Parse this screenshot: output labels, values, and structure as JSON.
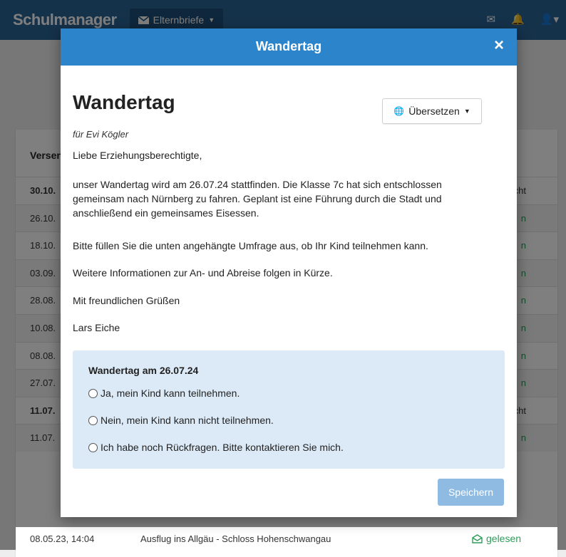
{
  "app": {
    "brand": "Schulmanager",
    "nav_dropdown": "Elternbriefe",
    "nav_icons": [
      "mail-icon",
      "bell-icon",
      "user-icon"
    ]
  },
  "list": {
    "header": "Versendet",
    "rows": [
      {
        "date": "30.10.",
        "status": "cht",
        "bold": true
      },
      {
        "date": "26.10.",
        "status": "n",
        "bold": false
      },
      {
        "date": "18.10.",
        "status": "n",
        "bold": false
      },
      {
        "date": "03.09.",
        "status": "n",
        "bold": false
      },
      {
        "date": "28.08.",
        "status": "n",
        "bold": false
      },
      {
        "date": "10.08.",
        "status": "n",
        "bold": false
      },
      {
        "date": "08.08.",
        "status": "n",
        "bold": false
      },
      {
        "date": "27.07.",
        "status": "n",
        "bold": false
      },
      {
        "date": "11.07.",
        "status": "cht",
        "bold": true
      },
      {
        "date": "11.07.",
        "status": "n",
        "bold": false
      }
    ],
    "last_row": {
      "date": "08.05.23, 14:04",
      "title": "Ausflug ins Allgäu - Schloss Hohenschwangau",
      "status": "gelesen"
    }
  },
  "modal": {
    "header_title": "Wandertag",
    "close_label": "×",
    "letter_title": "Wandertag",
    "translate_label": "Übersetzen",
    "recipient": "für Evi Kögler",
    "paragraphs": [
      "Liebe Erziehungsberechtigte,",
      "unser Wandertag wird am 26.07.24 stattfinden. Die Klasse 7c hat sich entschlossen gemeinsam nach Nürnberg zu fahren. Geplant ist eine Führung durch die Stadt und anschließend ein gemeinsames Eisessen.",
      "Bitte füllen Sie die unten angehängte Umfrage aus, ob Ihr Kind teilnehmen kann.",
      "Weitere Informationen zur An- und Abreise folgen in Kürze.",
      "Mit freundlichen Grüßen",
      "Lars Eiche"
    ],
    "survey": {
      "title": "Wandertag am 26.07.24",
      "options": [
        "Ja, mein Kind kann teilnehmen.",
        "Nein, mein Kind kann nicht teilnehmen.",
        "Ich habe noch Rückfragen. Bitte kontaktieren Sie mich."
      ]
    },
    "save_label": "Speichern"
  },
  "colors": {
    "navbar": "#2a6497",
    "modal_header": "#2c84cb",
    "survey_bg": "#dce9f6",
    "save_button": "#8fbbe2",
    "read_status": "#2e9e5a"
  }
}
